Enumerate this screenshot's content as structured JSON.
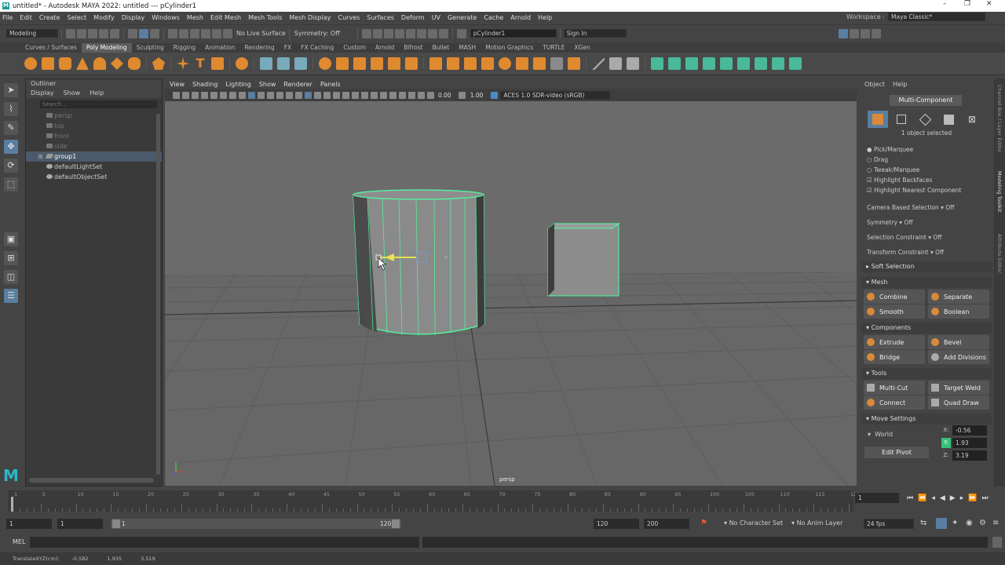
{
  "window": {
    "title": "untitled* - Autodesk MAYA 2022: untitled   ---   pCylinder1",
    "minimize": "–",
    "restore": "❐",
    "close": "✕"
  },
  "menubar": {
    "items": [
      "File",
      "Edit",
      "Create",
      "Select",
      "Modify",
      "Display",
      "Windows",
      "Mesh",
      "Edit Mesh",
      "Mesh Tools",
      "Mesh Display",
      "Curves",
      "Surfaces",
      "Deform",
      "UV",
      "Generate",
      "Cache",
      "Arnold",
      "Help"
    ],
    "workspace_label": "Workspace :",
    "workspace_value": "Maya Classic*"
  },
  "statusline": {
    "mode": "Modeling",
    "live_surface": "No Live Surface",
    "symmetry": "Symmetry: Off",
    "object_field": "pCylinder1",
    "sign_in": "Sign In"
  },
  "shelf": {
    "tabs": [
      "Curves / Surfaces",
      "Poly Modeling",
      "Sculpting",
      "Rigging",
      "Animation",
      "Rendering",
      "FX",
      "FX Caching",
      "Custom",
      "Arnold",
      "Bifrost",
      "Bullet",
      "MASH",
      "Motion Graphics",
      "TURTLE",
      "XGen"
    ],
    "active_tab": "Poly Modeling"
  },
  "outliner": {
    "title": "Outliner",
    "menu": [
      "Display",
      "Show",
      "Help"
    ],
    "search_placeholder": "Search...",
    "items": [
      {
        "label": "persp",
        "state": "dim"
      },
      {
        "label": "top",
        "state": "dim"
      },
      {
        "label": "front",
        "state": "dim"
      },
      {
        "label": "side",
        "state": "dim"
      },
      {
        "label": "group1",
        "state": "sel"
      },
      {
        "label": "defaultLightSet",
        "state": "normal"
      },
      {
        "label": "defaultObjectSet",
        "state": "normal"
      }
    ]
  },
  "viewport": {
    "menu": [
      "View",
      "Shading",
      "Lighting",
      "Show",
      "Renderer",
      "Panels"
    ],
    "exposure": "0.00",
    "gamma": "1.00",
    "colorspace": "ACES 1.0 SDR-video (sRGB)",
    "camera_label": "persp",
    "colors": {
      "bg": "#6b6b6b",
      "grid": "#5a5a5a",
      "mesh": "#8c8c8c",
      "highlight": "#4dffa0"
    }
  },
  "modeling_toolkit": {
    "tabs": [
      "Object",
      "Help"
    ],
    "mode_button": "Multi-Component",
    "selection_info": "1 object selected",
    "pick_options": [
      "Pick/Marquee",
      "Drag",
      "Tweak/Marquee"
    ],
    "checks": [
      "Highlight Backfaces",
      "Highlight Nearest Component"
    ],
    "camera_based_selection": "Camera Based Selection",
    "symmetry": "Symmetry",
    "selection_constraint": "Selection Constraint",
    "transform_constraint": "Transform Constraint",
    "off": "Off",
    "soft_selection": "Soft Selection",
    "mesh_section": "Mesh",
    "mesh_buttons": [
      "Combine",
      "Separate",
      "Smooth",
      "Boolean"
    ],
    "components_section": "Components",
    "component_buttons": [
      "Extrude",
      "Bevel",
      "Bridge",
      "Add Divisions"
    ],
    "tools_section": "Tools",
    "tool_buttons": [
      "Multi-Cut",
      "Target Weld",
      "Connect",
      "Quad Draw"
    ],
    "move_settings": "Move Settings",
    "space": "World",
    "edit_pivot": "Edit Pivot",
    "x_label": "X:",
    "x": "-0.56",
    "y_label": "Y:",
    "y": "1.93",
    "z_label": "Z:",
    "z": "3.19",
    "side_tabs": [
      "Channel Box / Layer Editor",
      "Modeling Toolkit",
      "Attribute Editor"
    ]
  },
  "timeline": {
    "ticks": [
      "1",
      "5",
      "10",
      "15",
      "20",
      "25",
      "30",
      "35",
      "40",
      "45",
      "50",
      "55",
      "60",
      "65",
      "70",
      "75",
      "80",
      "85",
      "90",
      "95",
      "100",
      "105",
      "110",
      "115",
      "120"
    ],
    "current_frame": "1"
  },
  "range": {
    "start": "1",
    "playback_start": "1",
    "slider_start": "1",
    "slider_end": "120",
    "playback_end": "120",
    "end": "200",
    "character_set": "No Character Set",
    "anim_layer": "No Anim Layer",
    "fps": "24 fps"
  },
  "commandline": {
    "lang": "MEL"
  },
  "helpline": {
    "label": "TranslateXYZ(cm):",
    "x": "-0.582",
    "y": "1.935",
    "z": "3.519"
  }
}
